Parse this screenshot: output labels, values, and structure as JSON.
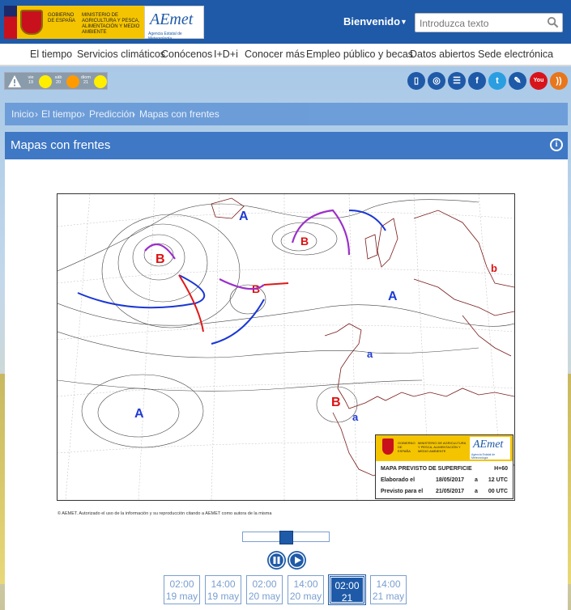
{
  "header": {
    "gov": {
      "line1": "GOBIERNO DE ESPAÑA",
      "line2": "MINISTERIO DE AGRICULTURA Y PESCA, ALIMENTACIÓN Y MEDIO AMBIENTE"
    },
    "logo": {
      "name": "AEmet",
      "sub": "Agencia Estatal de Meteorología"
    },
    "welcome": "Bienvenido",
    "search_placeholder": "Introduzca texto"
  },
  "nav": [
    "El tiempo",
    "Servicios climáticos",
    "Conócenos",
    "I+D+i",
    "Conocer más",
    "Empleo público y becas",
    "Datos abiertos",
    "Sede electrónica"
  ],
  "warnings": {
    "days": [
      {
        "day": "vie",
        "num": "19",
        "color": "#ffee00"
      },
      {
        "day": "sáb",
        "num": "20",
        "color": "#ff9a00"
      },
      {
        "day": "diom",
        "num": "21",
        "color": "#ffee00"
      }
    ]
  },
  "social_icons": [
    "mobile-icon",
    "app-icon",
    "list-icon",
    "facebook-icon",
    "twitter-icon",
    "blog-icon",
    "youtube-icon",
    "rss-icon"
  ],
  "breadcrumb": [
    "Inicio",
    "El tiempo",
    "Predicción",
    "Mapas con frentes"
  ],
  "panel": {
    "title": "Mapas con frentes"
  },
  "map": {
    "legend_title": "MAPA PREVISTO DE SUPERFICIE",
    "horizon": "H+60",
    "elaborado_label": "Elaborado el",
    "elaborado_date": "18/05/2017",
    "elaborado_at": "a",
    "elaborado_time": "12 UTC",
    "previsto_label": "Previsto para el",
    "previsto_date": "21/05/2017",
    "previsto_at": "a",
    "previsto_time": "00 UTC",
    "credit": "© AEMET. Autorizado el uso de la información y su reproducción citando a AEMET como autora de la misma"
  },
  "timeline": [
    {
      "time": "02:00",
      "date": "19 may"
    },
    {
      "time": "14:00",
      "date": "19 may"
    },
    {
      "time": "02:00",
      "date": "20 may"
    },
    {
      "time": "14:00",
      "date": "20 may"
    },
    {
      "time": "02:00",
      "date": "21 may",
      "selected": true
    },
    {
      "time": "14:00",
      "date": "21 may"
    }
  ],
  "colors": {
    "brand": "#1e5aa8",
    "high": "#1f3bd1",
    "low": "#d11",
    "warm": "#e01818",
    "cold": "#1a36d6",
    "occluded": "#9b2fc9"
  }
}
